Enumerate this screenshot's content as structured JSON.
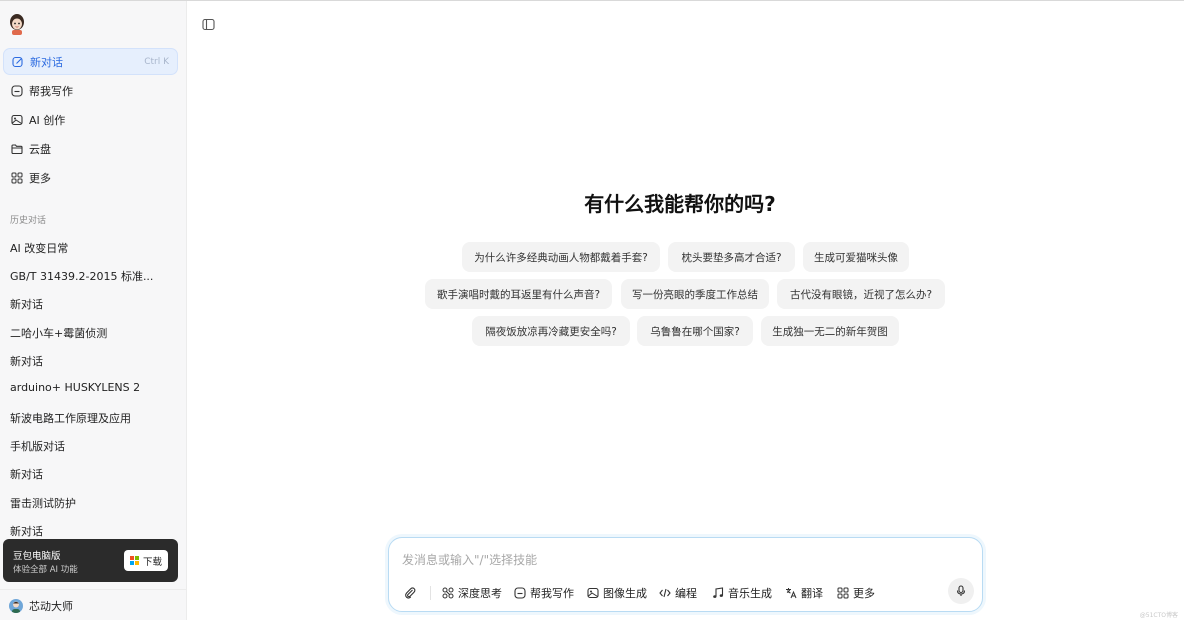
{
  "sidebar": {
    "nav": [
      {
        "label": "新对话",
        "shortcut": "Ctrl K",
        "icon": "compose-icon",
        "active": true
      },
      {
        "label": "帮我写作",
        "icon": "writing-icon"
      },
      {
        "label": "AI 创作",
        "icon": "image-icon"
      },
      {
        "label": "云盘",
        "icon": "folder-icon"
      },
      {
        "label": "更多",
        "icon": "grid-icon"
      }
    ],
    "history_title": "历史对话",
    "history": [
      "AI 改变日常",
      "GB/T 31439.2-2015 标准...",
      "新对话",
      "二哈小车+霉菌侦测",
      "新对话",
      "arduino+ HUSKYLENS 2",
      "斩波电路工作原理及应用",
      "手机版对话",
      "新对话",
      "雷击测试防护",
      "新对话"
    ],
    "promo": {
      "title": "豆包电脑版",
      "subtitle": "体验全部 AI 功能",
      "button": "下载"
    },
    "user": {
      "name": "芯动大师"
    }
  },
  "main": {
    "headline": "有什么我能帮你的吗?",
    "suggestions": [
      [
        "为什么许多经典动画人物都戴着手套?",
        "枕头要垫多高才合适?",
        "生成可爱猫咪头像"
      ],
      [
        "歌手演唱时戴的耳返里有什么声音?",
        "写一份亮眼的季度工作总结",
        "古代没有眼镜，近视了怎么办?"
      ],
      [
        "隔夜饭放凉再冷藏更安全吗?",
        "乌鲁鲁在哪个国家?",
        "生成独一无二的新年贺图"
      ]
    ]
  },
  "composer": {
    "placeholder": "发消息或输入\"/\"选择技能",
    "tools": [
      {
        "label": "深度思考",
        "icon": "deep-think-icon"
      },
      {
        "label": "帮我写作",
        "icon": "writing-icon"
      },
      {
        "label": "图像生成",
        "icon": "image-icon"
      },
      {
        "label": "编程",
        "icon": "code-icon"
      },
      {
        "label": "音乐生成",
        "icon": "music-icon"
      },
      {
        "label": "翻译",
        "icon": "translate-icon"
      },
      {
        "label": "更多",
        "icon": "grid-icon"
      }
    ]
  },
  "watermark": "@51CTO博客",
  "colors": {
    "accent": "#2b6ae0",
    "active_bg": "#e6effd",
    "chip_bg": "#f3f3f3",
    "promo_bg": "#2b2b2b"
  }
}
